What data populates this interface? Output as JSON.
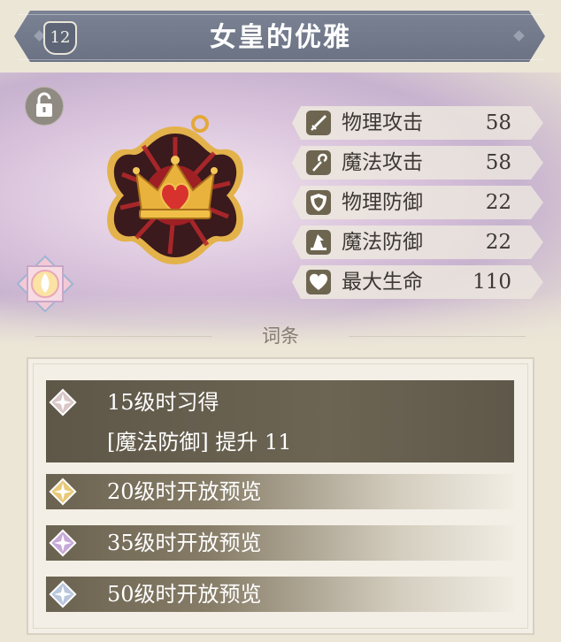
{
  "header": {
    "level": "12",
    "title": "女皇的优雅"
  },
  "stats": [
    {
      "icon": "sword-icon",
      "label": "物理攻击",
      "value": "58"
    },
    {
      "icon": "staff-icon",
      "label": "魔法攻击",
      "value": "58"
    },
    {
      "icon": "shield-icon",
      "label": "物理防御",
      "value": "22"
    },
    {
      "icon": "wizard-hat-icon",
      "label": "魔法防御",
      "value": "22"
    },
    {
      "icon": "heart-icon",
      "label": "最大生命",
      "value": "110"
    }
  ],
  "affix": {
    "heading": "词条",
    "items": [
      {
        "label": "15级时习得",
        "desc": "[魔法防御] 提升 11",
        "gem_color": "#d9c6c6"
      },
      {
        "label": "20级时开放预览",
        "gem_color": "#e8c978"
      },
      {
        "label": "35级时开放预览",
        "gem_color": "#c7a9d8"
      },
      {
        "label": "50级时开放预览",
        "gem_color": "#b9c6dc"
      }
    ]
  },
  "colors": {
    "header_bg": "#6a7283",
    "stat_icon_bg": "#6e6550",
    "active_row_bg": "#6d6553",
    "medal_red": "#b3282c",
    "medal_gold": "#e3a93a"
  }
}
